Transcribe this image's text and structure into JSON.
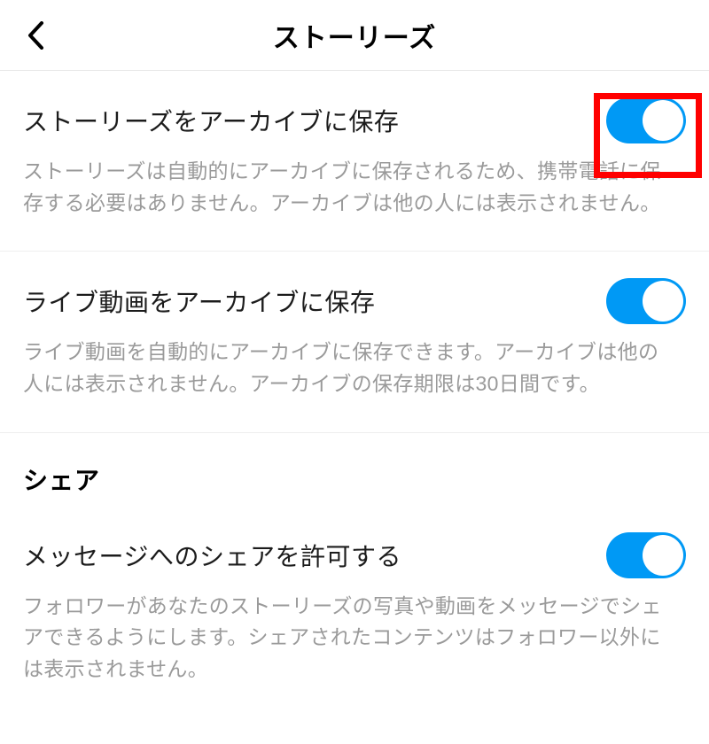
{
  "header": {
    "title": "ストーリーズ"
  },
  "settings": {
    "archive_stories": {
      "title": "ストーリーズをアーカイブに保存",
      "description": "ストーリーズは自動的にアーカイブに保存されるため、携帯電話に保存する必要はありません。アーカイブは他の人には表示されません。",
      "enabled": true
    },
    "archive_live": {
      "title": "ライブ動画をアーカイブに保存",
      "description": "ライブ動画を自動的にアーカイブに保存できます。アーカイブは他の人には表示されません。アーカイブの保存期限は30日間です。",
      "enabled": true
    }
  },
  "share_section": {
    "header": "シェア",
    "allow_message_share": {
      "title": "メッセージへのシェアを許可する",
      "description": "フォロワーがあなたのストーリーズの写真や動画をメッセージでシェアできるようにします。シェアされたコンテンツはフォロワー以外には表示されません。",
      "enabled": true
    }
  }
}
